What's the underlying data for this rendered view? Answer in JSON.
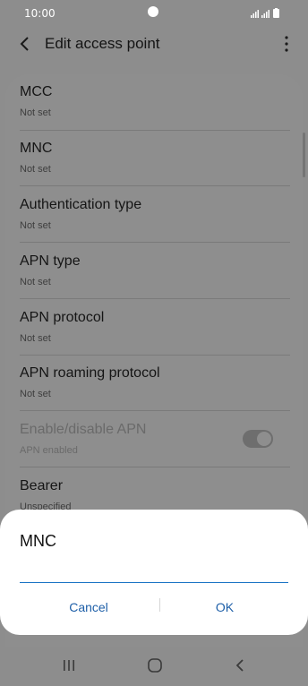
{
  "status_bar": {
    "time": "10:00"
  },
  "header": {
    "title": "Edit access point"
  },
  "settings": [
    {
      "label": "MCC",
      "value": "Not set"
    },
    {
      "label": "MNC",
      "value": "Not set"
    },
    {
      "label": "Authentication type",
      "value": "Not set"
    },
    {
      "label": "APN type",
      "value": "Not set"
    },
    {
      "label": "APN protocol",
      "value": "Not set"
    },
    {
      "label": "APN roaming protocol",
      "value": "Not set"
    },
    {
      "label": "Enable/disable APN",
      "value": "APN enabled",
      "toggle_on": true,
      "disabled": true
    },
    {
      "label": "Bearer",
      "value": "Unspecified"
    }
  ],
  "dialog": {
    "title": "MNC",
    "input_value": "",
    "cancel_label": "Cancel",
    "ok_label": "OK"
  },
  "colors": {
    "accent": "#1a73c4",
    "button_text": "#1e5fa8",
    "overlay_background": "#8e8e8e"
  },
  "icons": [
    "back-arrow-icon",
    "more-options-icon",
    "signal-icon",
    "battery-icon",
    "recent-apps-icon",
    "home-icon",
    "back-nav-icon"
  ]
}
